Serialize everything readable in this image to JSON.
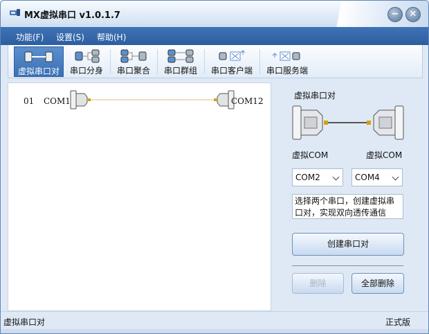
{
  "window": {
    "title": "MX虚拟串口  v1.0.1.7"
  },
  "menu": [
    "功能(F)",
    "设置(S)",
    "帮助(H)"
  ],
  "toolbar": {
    "items": [
      {
        "label": "虚拟串口对",
        "icon": "port-pair-icon",
        "active": true
      },
      {
        "label": "串口分身",
        "icon": "port-split-icon",
        "active": false
      },
      {
        "label": "串口聚合",
        "icon": "port-merge-icon",
        "active": false
      },
      {
        "label": "串口群组",
        "icon": "port-group-icon",
        "active": false
      },
      {
        "label": "串口客户端",
        "icon": "port-client-icon",
        "active": false
      },
      {
        "label": "串口服务端",
        "icon": "port-server-icon",
        "active": false
      }
    ]
  },
  "pair_list": [
    {
      "index": "01",
      "left_port": "COM11",
      "right_port": "COM12"
    }
  ],
  "side_panel": {
    "title": "虚拟串口对",
    "left_label": "虚拟COM",
    "right_label": "虚拟COM",
    "left_select": "COM2",
    "right_select": "COM4",
    "description": "选择两个串口，创建虚拟串口对，实现双向透传通信",
    "create_button": "创建串口对",
    "delete_button": "删除",
    "delete_all_button": "全部删除"
  },
  "status": {
    "left": "虚拟串口对",
    "right": "正式版"
  },
  "colors": {
    "menu_bar": "#2d5e9f",
    "accent": "#3a70b4",
    "link_line": "#c07a00"
  }
}
